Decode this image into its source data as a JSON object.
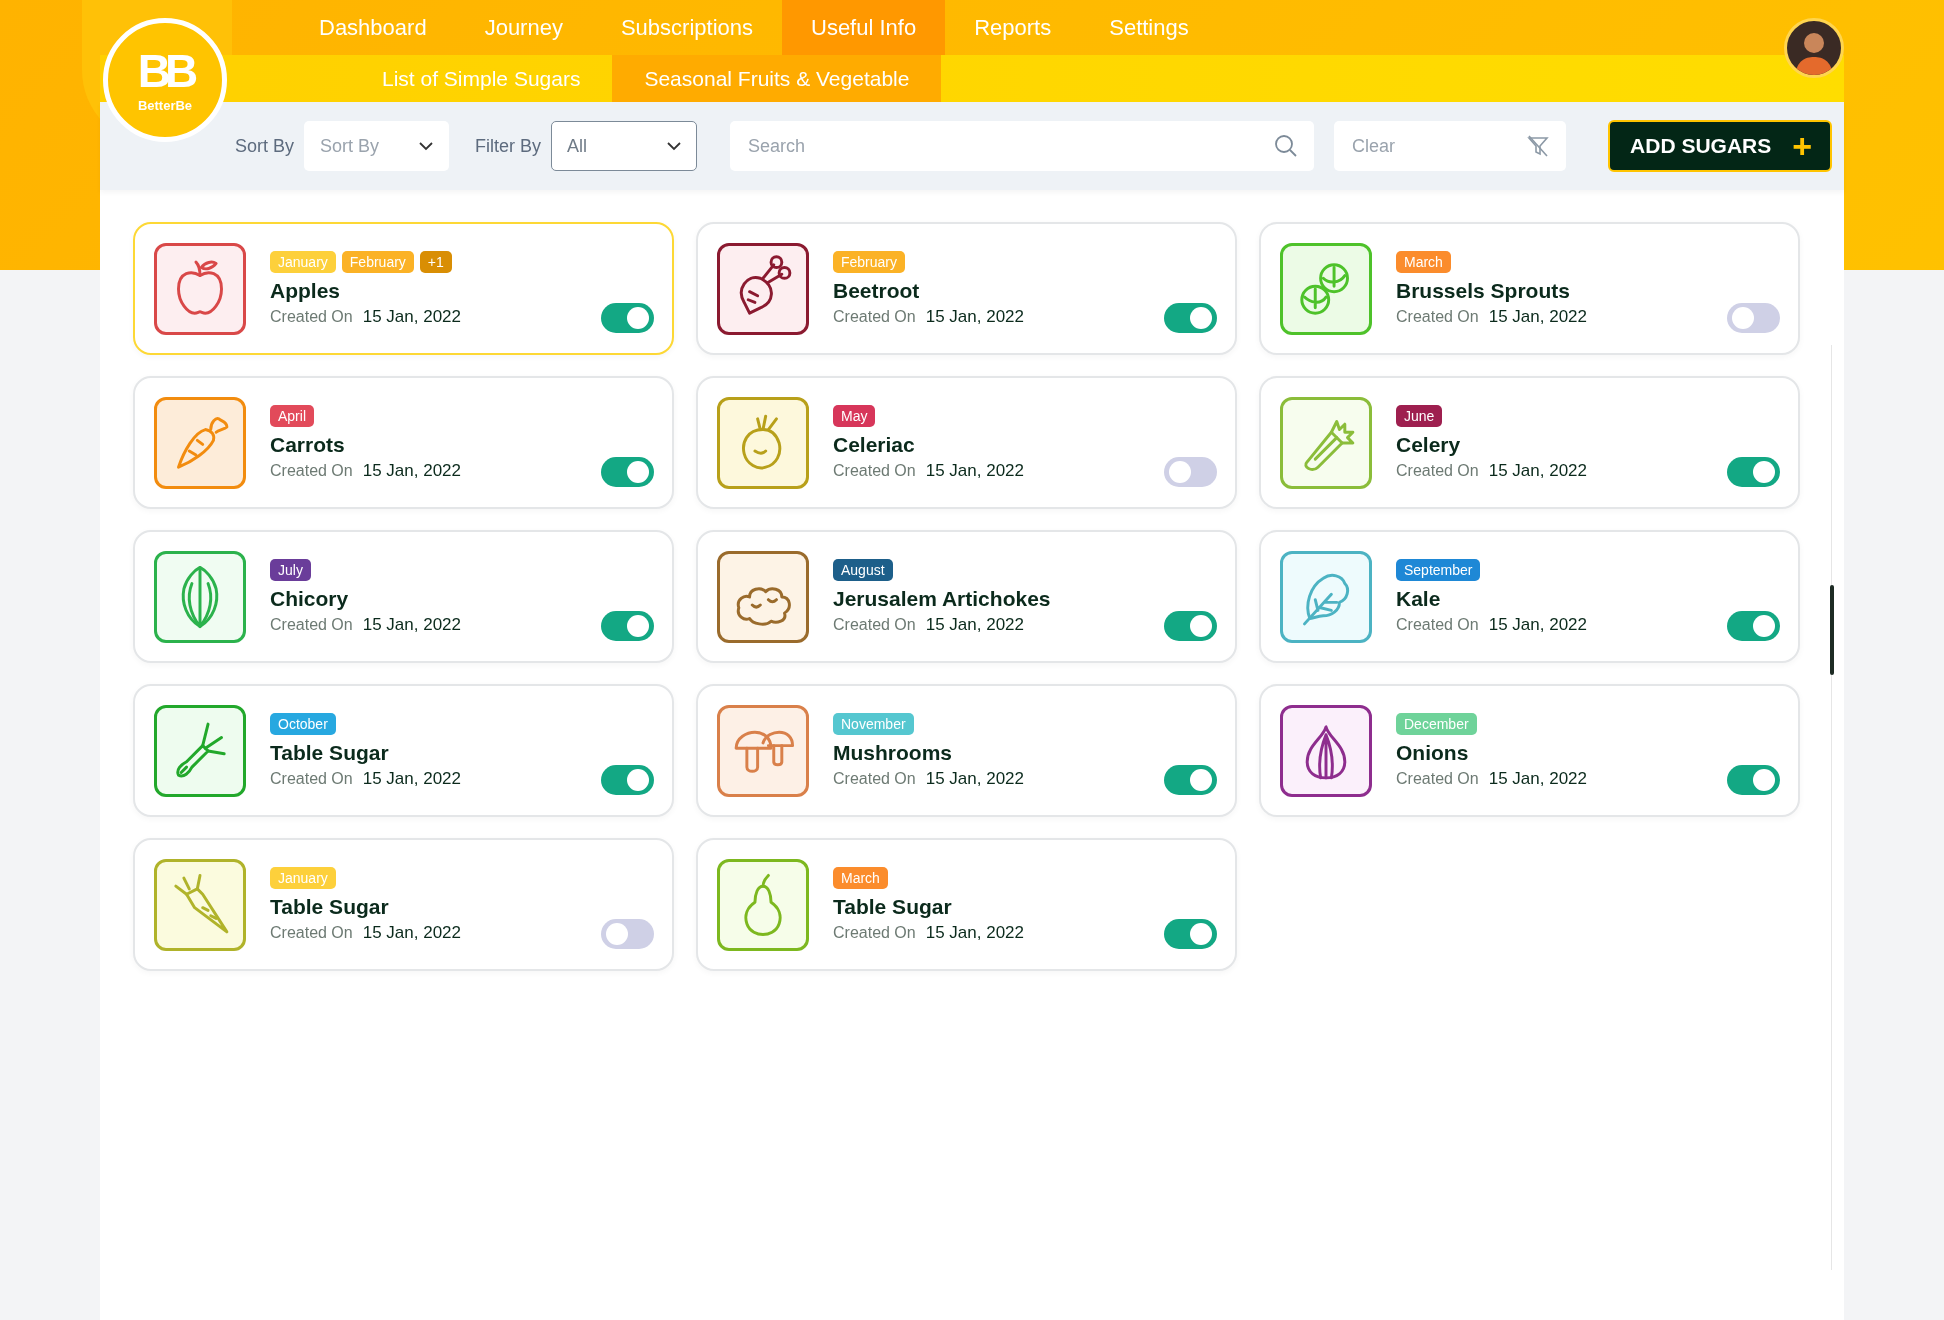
{
  "logo": {
    "mark": "BB",
    "name": "BetterBe"
  },
  "nav": [
    {
      "label": "Dashboard",
      "selected": false
    },
    {
      "label": "Journey",
      "selected": false
    },
    {
      "label": "Subscriptions",
      "selected": false
    },
    {
      "label": "Useful Info",
      "selected": true
    },
    {
      "label": "Reports",
      "selected": false
    },
    {
      "label": "Settings",
      "selected": false
    }
  ],
  "subnav": [
    {
      "label": "List of Simple Sugars",
      "selected": false
    },
    {
      "label": "Seasonal Fruits & Vegetable",
      "selected": true
    }
  ],
  "toolbar": {
    "sort_label": "Sort By",
    "sort": {
      "placeholder": "Sort By"
    },
    "filter_label": "Filter By",
    "filter": {
      "value": "All"
    },
    "search": {
      "placeholder": "Search"
    },
    "clear": {
      "placeholder": "Clear"
    },
    "add_button": "ADD SUGARS",
    "add_icon": "+"
  },
  "cards": [
    {
      "name": "Apples",
      "kind": "apple",
      "selected": true,
      "on": true,
      "created_label": "Created On",
      "date": "15 Jan, 2022",
      "months": [
        {
          "label": "January",
          "color": "#fdd03b"
        },
        {
          "label": "February",
          "color": "#fbb226"
        },
        {
          "label": "+1",
          "color": "#d98e04"
        }
      ]
    },
    {
      "name": "Beetroot",
      "kind": "beet",
      "selected": false,
      "on": true,
      "created_label": "Created On",
      "date": "15 Jan, 2022",
      "months": [
        {
          "label": "February",
          "color": "#fbb226"
        }
      ]
    },
    {
      "name": "Brussels Sprouts",
      "kind": "sprouts",
      "selected": false,
      "on": false,
      "created_label": "Created On",
      "date": "15 Jan, 2022",
      "months": [
        {
          "label": "March",
          "color": "#fb8c2c"
        }
      ]
    },
    {
      "name": "Carrots",
      "kind": "carrot",
      "selected": false,
      "on": true,
      "created_label": "Created On",
      "date": "15 Jan, 2022",
      "months": [
        {
          "label": "April",
          "color": "#e24a5a"
        }
      ]
    },
    {
      "name": "Celeriac",
      "kind": "celeriac",
      "selected": false,
      "on": false,
      "created_label": "Created On",
      "date": "15 Jan, 2022",
      "months": [
        {
          "label": "May",
          "color": "#d7365a"
        }
      ]
    },
    {
      "name": "Celery",
      "kind": "celery",
      "selected": false,
      "on": true,
      "created_label": "Created On",
      "date": "15 Jan, 2022",
      "months": [
        {
          "label": "June",
          "color": "#9e1f4f"
        }
      ]
    },
    {
      "name": "Chicory",
      "kind": "chicory",
      "selected": false,
      "on": true,
      "created_label": "Created On",
      "date": "15 Jan, 2022",
      "months": [
        {
          "label": "July",
          "color": "#6a3d9a"
        }
      ]
    },
    {
      "name": "Jerusalem Artichokes",
      "kind": "ginger",
      "selected": false,
      "on": true,
      "created_label": "Created On",
      "date": "15 Jan, 2022",
      "months": [
        {
          "label": "August",
          "color": "#1d5f8a"
        }
      ]
    },
    {
      "name": "Kale",
      "kind": "kale",
      "selected": false,
      "on": true,
      "created_label": "Created On",
      "date": "15 Jan, 2022",
      "months": [
        {
          "label": "September",
          "color": "#1e88d6"
        }
      ]
    },
    {
      "name": "Table Sugar",
      "kind": "leek",
      "selected": false,
      "on": true,
      "created_label": "Created On",
      "date": "15 Jan, 2022",
      "months": [
        {
          "label": "October",
          "color": "#27a8e0"
        }
      ]
    },
    {
      "name": "Mushrooms",
      "kind": "mushroom",
      "selected": false,
      "on": true,
      "created_label": "Created On",
      "date": "15 Jan, 2022",
      "months": [
        {
          "label": "November",
          "color": "#55c7d0"
        }
      ]
    },
    {
      "name": "Onions",
      "kind": "onion",
      "selected": false,
      "on": true,
      "created_label": "Created On",
      "date": "15 Jan, 2022",
      "months": [
        {
          "label": "December",
          "color": "#6fd39a"
        }
      ]
    },
    {
      "name": "Table Sugar",
      "kind": "parsnip",
      "selected": false,
      "on": false,
      "created_label": "Created On",
      "date": "15 Jan, 2022",
      "months": [
        {
          "label": "January",
          "color": "#fdd03b"
        }
      ]
    },
    {
      "name": "Table Sugar",
      "kind": "pear",
      "selected": false,
      "on": true,
      "created_label": "Created On",
      "date": "15 Jan, 2022",
      "months": [
        {
          "label": "March",
          "color": "#fb8c2c"
        }
      ]
    }
  ]
}
